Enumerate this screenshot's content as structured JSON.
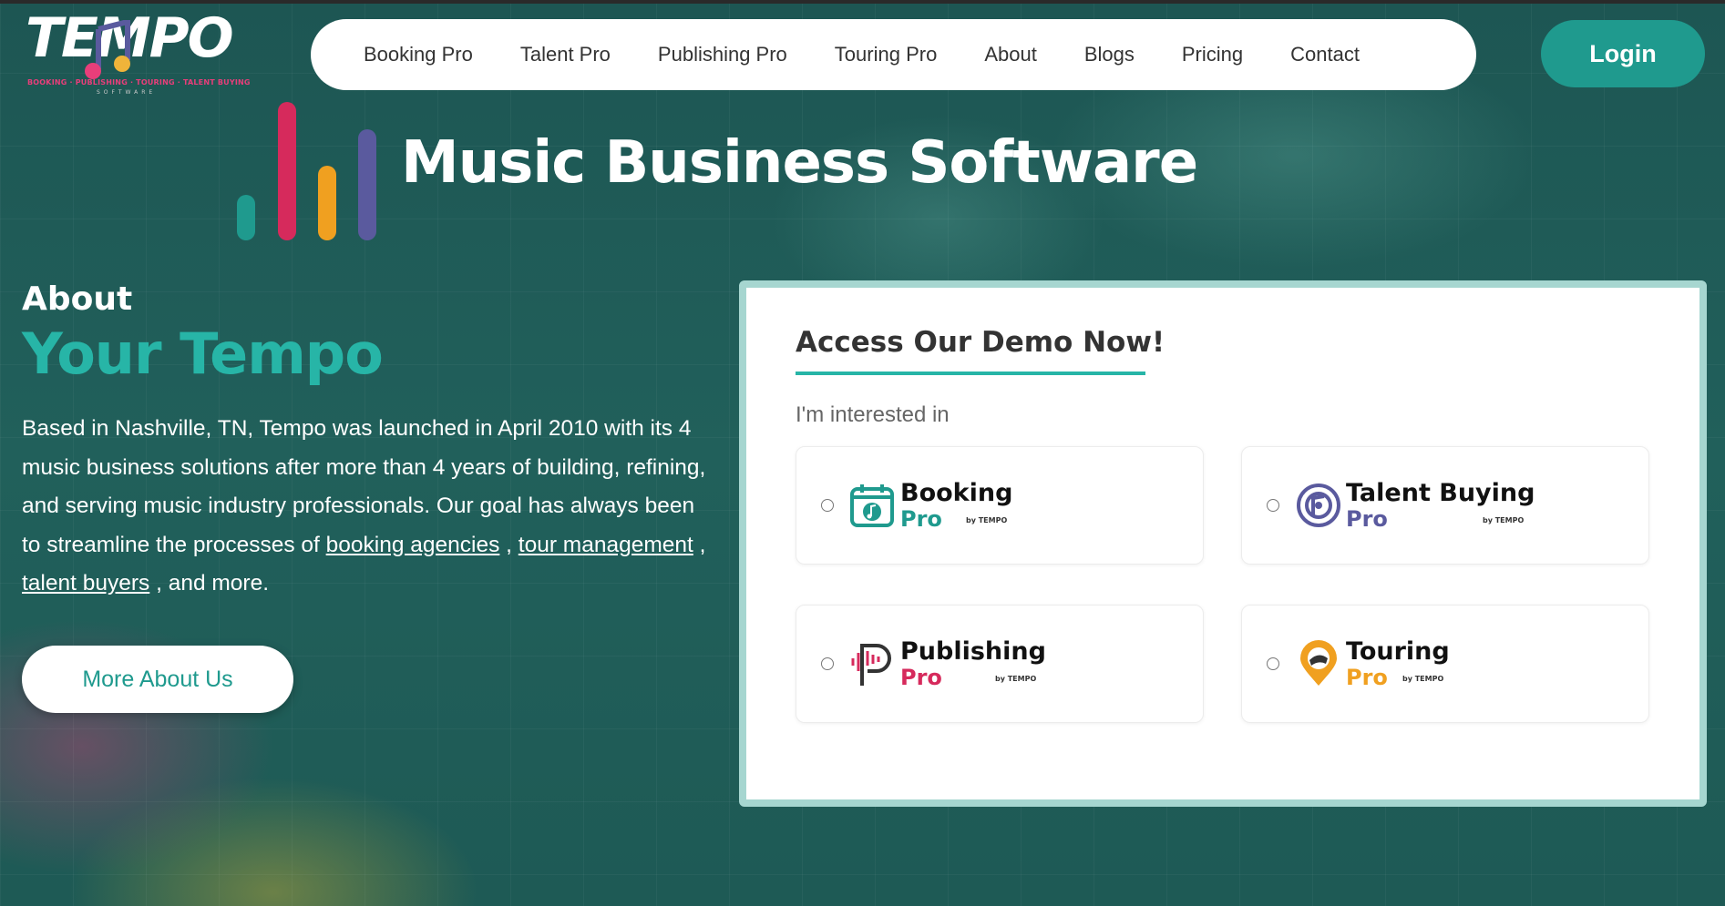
{
  "brand": {
    "name": "TEMPO",
    "tagline": "BOOKING · PUBLISHING · TOURING · TALENT BUYING",
    "sub": "SOFTWARE"
  },
  "nav": {
    "items": [
      "Booking Pro",
      "Talent Pro",
      "Publishing Pro",
      "Touring Pro",
      "About",
      "Blogs",
      "Pricing",
      "Contact"
    ],
    "login_label": "Login"
  },
  "hero": {
    "title": "Music Business Software"
  },
  "about": {
    "label": "About",
    "title": "Your Tempo",
    "text_intro": "Based in Nashville, TN, Tempo was launched in April 2010 with its 4 music business solutions after more than 4 years of building, refining, and serving music industry professionals. Our goal has always been to streamline the processes of ",
    "link_booking": "booking agencies",
    "sep1": " , ",
    "link_tour": "tour management",
    "sep2": " , ",
    "link_talent": "talent buyers",
    "text_outro": " , and more.",
    "button_label": "More About Us"
  },
  "demo": {
    "title": "Access Our Demo Now!",
    "interest_label": "I'm interested in",
    "by_label": "by TEMPO",
    "options": [
      {
        "name": "Booking",
        "pro": "Pro",
        "color": "#1f9a8e"
      },
      {
        "name": "Talent Buying",
        "pro": "Pro",
        "color": "#5a5a9e"
      },
      {
        "name": "Publishing",
        "pro": "Pro",
        "color": "#d62a5c"
      },
      {
        "name": "Touring",
        "pro": "Pro",
        "color": "#f0a020"
      }
    ]
  },
  "colors": {
    "accent": "#27b5a7",
    "button": "#1f9a8e",
    "background": "#1f5b57"
  }
}
